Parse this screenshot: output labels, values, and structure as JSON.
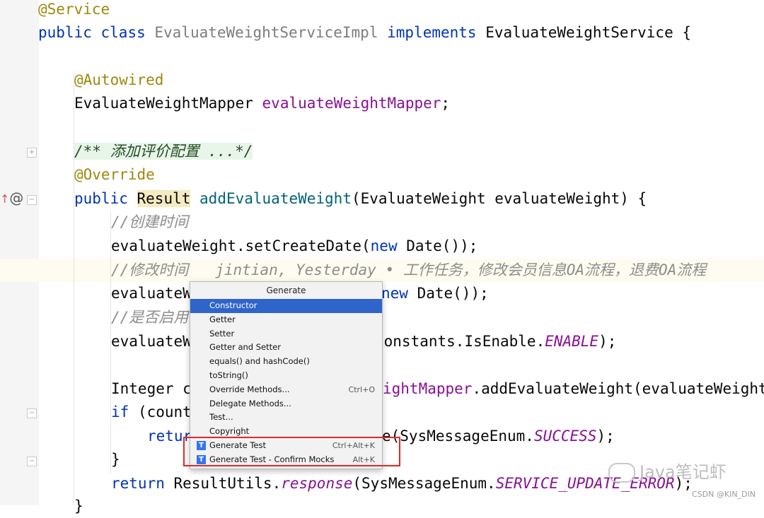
{
  "code": {
    "l1_annotation": "@Service",
    "l2": {
      "public": "public",
      "class": "class",
      "name": "EvaluateWeightServiceImpl",
      "implements": "implements",
      "iface": "EvaluateWeightService",
      "brace": " {"
    },
    "l4_annotation": "@Autowired",
    "l5": {
      "type": "EvaluateWeightMapper",
      "field": "evaluateWeightMapper",
      "semi": ";"
    },
    "l7_doc": "/** 添加评价配置 ...*/",
    "l8_annotation": "@Override",
    "l9": {
      "public": "public",
      "result": "Result",
      "method": "addEvaluateWeight",
      "params": "(EvaluateWeight evaluateWeight) {"
    },
    "l10_comment": "//创建时间",
    "l11": {
      "pre": "evaluateWeight.setCreateDate(",
      "new": "new",
      "post": " Date());"
    },
    "l12_comment": "//修改时间",
    "l12_blame": "jintian, Yesterday • 工作任务，修改会员信息OA流程，退费OA流程",
    "l13": {
      "pre": "evaluateW",
      "new": "new",
      "post": " Date());"
    },
    "l14_comment": "//是否启用",
    "l15": {
      "pre": "evaluateW",
      "mid": "Constants.IsEnable.",
      "enable": "ENABLE",
      "post": ");"
    },
    "l17": {
      "pre": "Integer c",
      "field": "ightMapper",
      "post": ".addEvaluateWeight(evaluateWeight"
    },
    "l18": {
      "if": "if",
      "post": " (count"
    },
    "l19": {
      "ret": "retur",
      "post": "e(SysMessageEnum.",
      "success": "SUCCESS",
      "end": ");"
    },
    "l20": "}",
    "l21": {
      "return": "return",
      "pre": " ResultUtils.",
      "response": "response",
      "mid": "(SysMessageEnum.",
      "err": "SERVICE_UPDATE_ERROR",
      "end": ");"
    },
    "l22": "}"
  },
  "popup": {
    "title": "Generate",
    "items": [
      {
        "label": "Constructor",
        "shortcut": "",
        "selected": true
      },
      {
        "label": "Getter",
        "shortcut": ""
      },
      {
        "label": "Setter",
        "shortcut": ""
      },
      {
        "label": "Getter and Setter",
        "shortcut": ""
      },
      {
        "label": "equals() and hashCode()",
        "shortcut": ""
      },
      {
        "label": "toString()",
        "shortcut": ""
      },
      {
        "label": "Override Methods...",
        "shortcut": "Ctrl+O"
      },
      {
        "label": "Delegate Methods...",
        "shortcut": ""
      },
      {
        "label": "Test...",
        "shortcut": ""
      },
      {
        "label": "Copyright",
        "shortcut": ""
      },
      {
        "label": "Generate Test",
        "shortcut": "Ctrl+Alt+K",
        "icon": "T"
      },
      {
        "label": "Generate Test - Confirm Mocks",
        "shortcut": "Alt+K",
        "icon": "T"
      }
    ]
  },
  "gutter": {
    "override_marker": "@"
  },
  "watermark": {
    "text": "Java笔记虾",
    "credit": "CSDN @KIN_DIN"
  },
  "colors": {
    "selection": "#2f65ca",
    "highlight_box": "#e02828"
  }
}
